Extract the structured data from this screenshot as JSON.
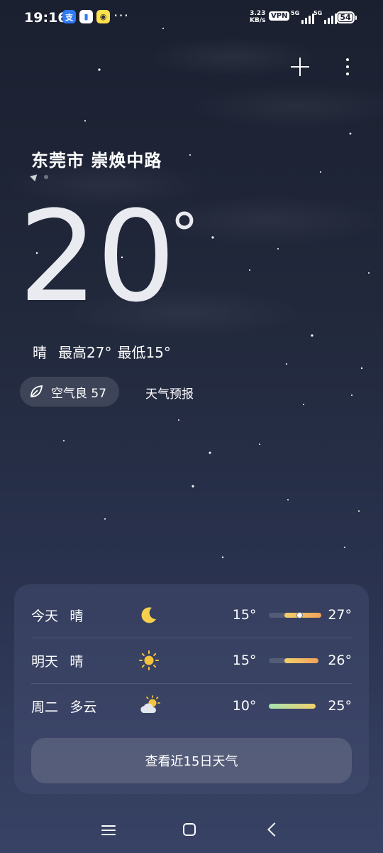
{
  "status_bar": {
    "time": "19:16",
    "net_speed_value": "3.23",
    "net_speed_unit": "KB/s",
    "vpn": "VPN",
    "sim1": "5G",
    "sim2": "5G",
    "battery": "54",
    "more_dots": "···"
  },
  "header": {
    "add_icon": "plus-icon",
    "menu_icon": "more-vertical-icon"
  },
  "location": {
    "name": "东莞市 崇焕中路"
  },
  "current": {
    "temperature": "20",
    "degree": "°",
    "condition": "晴",
    "high": "最高27°",
    "low": "最低15°"
  },
  "air_quality": {
    "label": "空气良 57",
    "icon": "leaf-icon"
  },
  "forecast_link": "天气预报",
  "daily": [
    {
      "day": "今天",
      "cond": "晴",
      "icon": "moon-icon",
      "low": "15°",
      "high": "27°",
      "range": [
        15,
        27
      ],
      "current": 20,
      "bar_colors": [
        "#f2d06b",
        "#f3a25a"
      ]
    },
    {
      "day": "明天",
      "cond": "晴",
      "icon": "sun-icon",
      "low": "15°",
      "high": "26°",
      "range": [
        15,
        26
      ],
      "bar_colors": [
        "#f2d06b",
        "#f3a25a"
      ]
    },
    {
      "day": "周二",
      "cond": "多云",
      "icon": "partly-cloudy-icon",
      "low": "10°",
      "high": "25°",
      "range": [
        10,
        25
      ],
      "bar_colors": [
        "#a7e3b2",
        "#f2d06b"
      ]
    }
  ],
  "daily_scale": [
    10,
    27
  ],
  "button_15day": "查看近15日天气"
}
